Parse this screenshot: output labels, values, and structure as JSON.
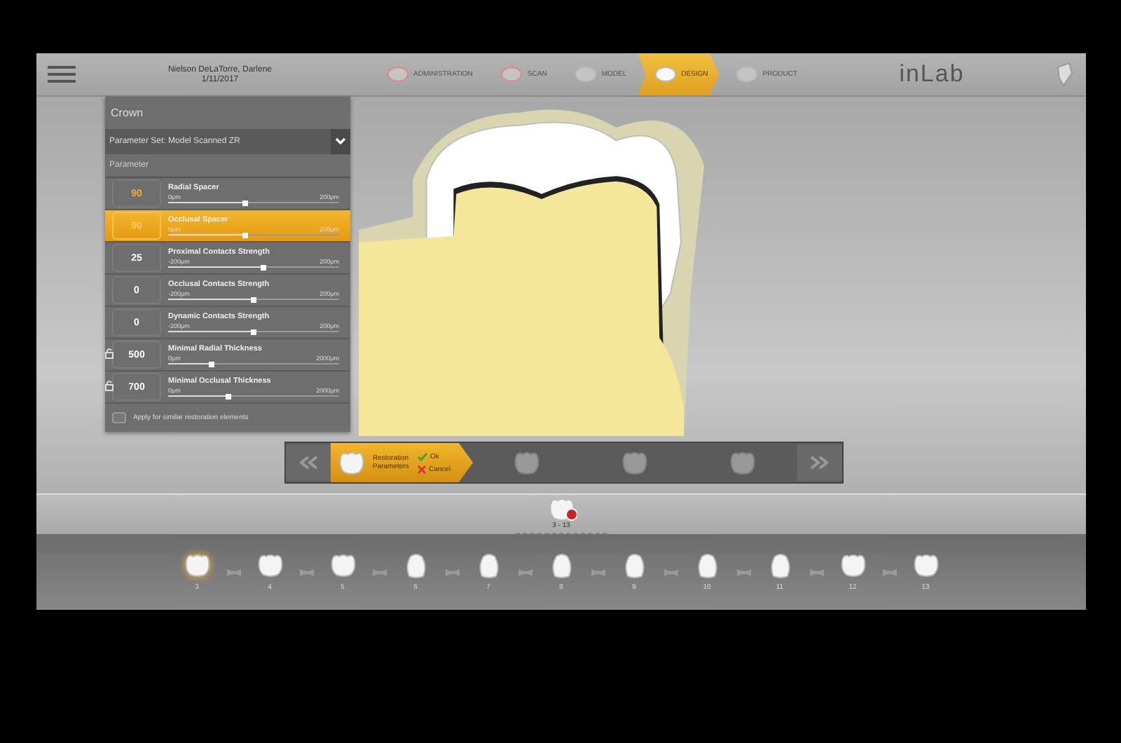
{
  "header": {
    "patient": "Nielson DeLaTorre, Darlene",
    "date": "1/11/2017",
    "brand": "inLab"
  },
  "workflow": [
    {
      "label": "ADMINISTRATION",
      "selected": false
    },
    {
      "label": "SCAN",
      "selected": false
    },
    {
      "label": "MODEL",
      "selected": false
    },
    {
      "label": "DESIGN",
      "selected": true
    },
    {
      "label": "PRODUCT",
      "selected": false
    }
  ],
  "panel": {
    "title": "Crown",
    "parameter_set": "Parameter Set: Model Scanned ZR",
    "section": "Parameter",
    "parameters": [
      {
        "name": "Radial Spacer",
        "value": "90",
        "min": "0μm",
        "max": "200μm",
        "level": 0.45,
        "selected": false,
        "locked": false
      },
      {
        "name": "Occlusal Spacer",
        "value": "90",
        "min": "0μm",
        "max": "200μm",
        "level": 0.45,
        "selected": true,
        "locked": false
      },
      {
        "name": "Proximal Contacts Strength",
        "value": "25",
        "min": "-200μm",
        "max": "200μm",
        "level": 0.56,
        "selected": false,
        "locked": false
      },
      {
        "name": "Occlusal Contacts Strength",
        "value": "0",
        "min": "-200μm",
        "max": "200μm",
        "level": 0.5,
        "selected": false,
        "locked": false
      },
      {
        "name": "Dynamic Contacts Strength",
        "value": "0",
        "min": "-200μm",
        "max": "200μm",
        "level": 0.5,
        "selected": false,
        "locked": false
      },
      {
        "name": "Minimal Radial Thickness",
        "value": "500",
        "min": "0μm",
        "max": "2000μm",
        "level": 0.25,
        "selected": false,
        "locked": true
      },
      {
        "name": "Minimal Occlusal Thickness",
        "value": "700",
        "min": "0μm",
        "max": "2000μm",
        "level": 0.35,
        "selected": false,
        "locked": true
      }
    ],
    "apply_label": "Apply for similar restoration elements",
    "apply_checked": false
  },
  "steps": {
    "active_label": "Restoration Parameters",
    "ok": "Ok",
    "cancel": "Cancel"
  },
  "selection": {
    "range": "3 - 13"
  },
  "teeth": [
    {
      "label": "3",
      "selected": true,
      "kind": "molar"
    },
    {
      "label": "4",
      "selected": false,
      "kind": "molar"
    },
    {
      "label": "5",
      "selected": false,
      "kind": "molar"
    },
    {
      "label": "6",
      "selected": false,
      "kind": "front"
    },
    {
      "label": "7",
      "selected": false,
      "kind": "front"
    },
    {
      "label": "8",
      "selected": false,
      "kind": "front"
    },
    {
      "label": "9",
      "selected": false,
      "kind": "front"
    },
    {
      "label": "10",
      "selected": false,
      "kind": "front"
    },
    {
      "label": "11",
      "selected": false,
      "kind": "front"
    },
    {
      "label": "12",
      "selected": false,
      "kind": "molar"
    },
    {
      "label": "13",
      "selected": false,
      "kind": "molar"
    }
  ]
}
